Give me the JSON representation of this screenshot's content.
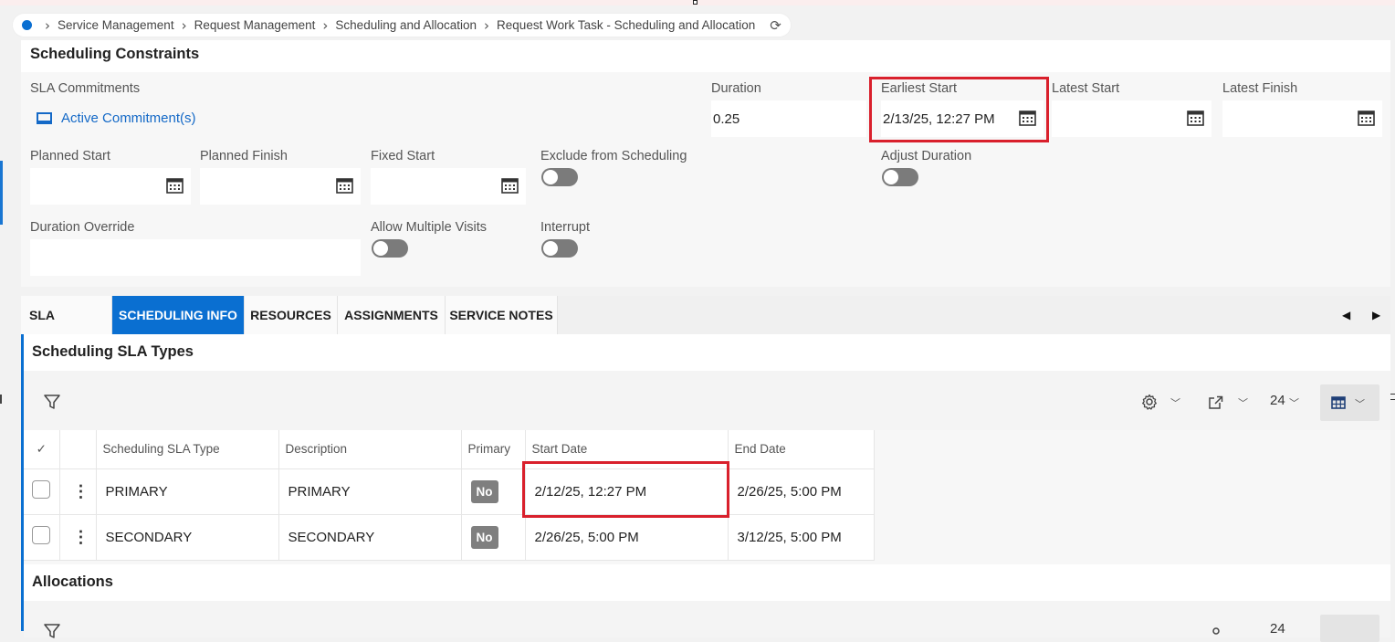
{
  "breadcrumb": {
    "items": [
      "Service Management",
      "Request Management",
      "Scheduling and Allocation",
      "Request Work Task - Scheduling and Allocation"
    ]
  },
  "constraints": {
    "title": "Scheduling Constraints",
    "sla_commitments_label": "SLA Commitments",
    "active_commitments_link": "Active Commitment(s)",
    "duration_label": "Duration",
    "duration_value": "0.25",
    "earliest_start_label": "Earliest Start",
    "earliest_start_value": "2/13/25, 12:27 PM",
    "latest_start_label": "Latest Start",
    "latest_start_value": "",
    "latest_finish_label": "Latest Finish",
    "latest_finish_value": "",
    "planned_start_label": "Planned Start",
    "planned_finish_label": "Planned Finish",
    "fixed_start_label": "Fixed Start",
    "exclude_label": "Exclude from Scheduling",
    "adjust_duration_label": "Adjust Duration",
    "duration_override_label": "Duration Override",
    "allow_multiple_visits_label": "Allow Multiple Visits",
    "interrupt_label": "Interrupt"
  },
  "tabs": [
    "SLA",
    "SCHEDULING INFO",
    "RESOURCES",
    "ASSIGNMENTS",
    "SERVICE NOTES"
  ],
  "active_tab": "SCHEDULING INFO",
  "sla_types": {
    "title": "Scheduling SLA Types",
    "page_size": "24",
    "columns": [
      "Scheduling SLA Type",
      "Description",
      "Primary",
      "Start Date",
      "End Date"
    ],
    "rows": [
      {
        "type": "PRIMARY",
        "description": "PRIMARY",
        "primary": "No",
        "start": "2/12/25, 12:27 PM",
        "end": "2/26/25, 5:00 PM"
      },
      {
        "type": "SECONDARY",
        "description": "SECONDARY",
        "primary": "No",
        "start": "2/26/25, 5:00 PM",
        "end": "3/12/25, 5:00 PM"
      }
    ]
  },
  "allocations": {
    "title": "Allocations",
    "page_size": "24"
  },
  "colors": {
    "accent": "#0a6fd1",
    "highlight": "#d9202c",
    "toggle_off": "#7b7b7b"
  }
}
